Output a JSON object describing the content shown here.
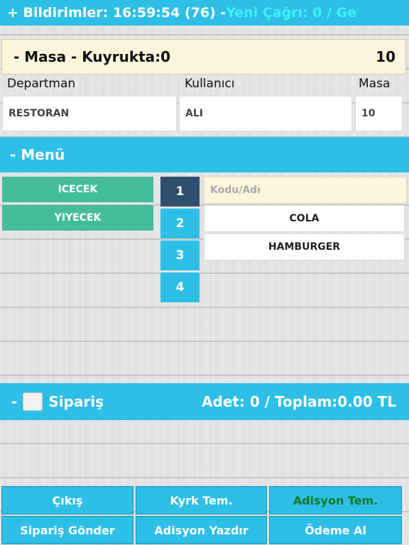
{
  "topbar": {
    "prefix": "+ Bildirimler: 16:59:54 (76) - ",
    "calls": "Yeni Çağrı: 0 / Ge"
  },
  "masa_bar": {
    "label": "- Masa - Kuyrukta:0",
    "number": "10"
  },
  "fields": {
    "department_label": "Departman",
    "department_value": "RESTORAN",
    "user_label": "Kullanıcı",
    "user_value": "ALI",
    "table_label": "Masa",
    "table_value": "10"
  },
  "menu": {
    "title": "- Menü",
    "categories": [
      "ICECEK",
      "YIYECEK"
    ],
    "pages": [
      "1",
      "2",
      "3",
      "4"
    ],
    "search_placeholder": "Kodu/Adı",
    "products": [
      "COLA",
      "HAMBURGER"
    ]
  },
  "order": {
    "prefix": "-",
    "title": "Sipariş",
    "summary": "Adet: 0 / Toplam:0.00 TL"
  },
  "buttons": {
    "exit": "Çıkış",
    "kitchen_template": "Kyrk Tem.",
    "receipt_template": "Adisyon Tem.",
    "send_order": "Sipariş Gönder",
    "print_receipt": "Adisyon Yazdır",
    "take_payment": "Ödeme Al"
  },
  "colors": {
    "accent": "#2ebfe6",
    "category": "#44bd9a",
    "active_page": "#2f4f6e",
    "header_cyan_text": "#3ef1ff",
    "green_text": "#137a23"
  }
}
